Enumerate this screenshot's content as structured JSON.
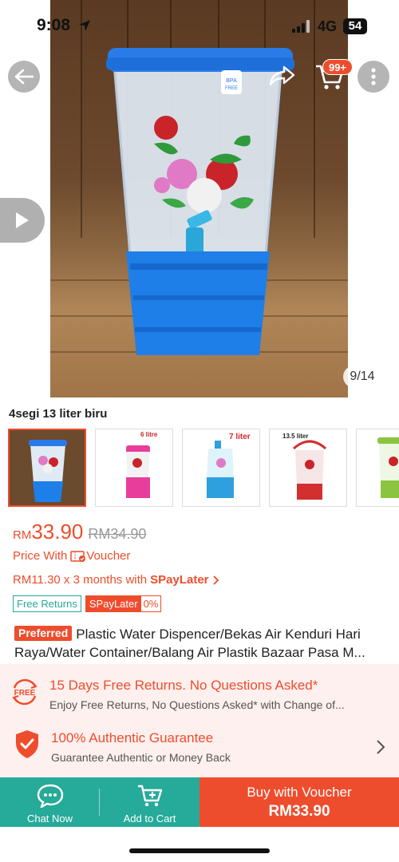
{
  "status": {
    "time": "9:08",
    "network": "4G",
    "battery": "54"
  },
  "top_nav": {
    "cart_badge": "99+"
  },
  "gallery": {
    "counter": "9/14"
  },
  "variation": {
    "name": "4segi 13 liter biru",
    "thumbs": [
      {
        "caption": ""
      },
      {
        "caption": "6 litre"
      },
      {
        "caption": "7 liter"
      },
      {
        "caption": "13.5 liter"
      },
      {
        "caption": ""
      }
    ]
  },
  "price": {
    "currency": "RM",
    "current": "33.90",
    "original": "RM34.90",
    "voucher_label": "Price With",
    "voucher_word": "Voucher",
    "installment_text": "RM11.30 x 3 months with",
    "installment_brand": "SPayLater"
  },
  "tags": {
    "free_returns": "Free Returns",
    "spaylater": "SPayLater",
    "spaylater_rate": "0%"
  },
  "product": {
    "badge": "Preferred",
    "title": "Plastic Water Dispencer/Bekas Air Kenduri Hari Raya/Water Container/Balang Air Plastik Bazaar Pasa M..."
  },
  "guarantees": [
    {
      "icon": "free-returns-icon",
      "title": "15 Days Free Returns. No Questions Asked*",
      "subtitle": "Enjoy Free Returns, No Questions Asked* with Change of..."
    },
    {
      "icon": "shield-check-icon",
      "title": "100% Authentic Guarantee",
      "subtitle": "Guarantee Authentic or Money Back"
    }
  ],
  "bottom_bar": {
    "chat_label": "Chat Now",
    "cart_label": "Add to Cart",
    "buy_label": "Buy with Voucher",
    "buy_price": "RM33.90"
  },
  "colors": {
    "accent": "#ee4d2d",
    "teal": "#26aa99",
    "guarantee_bg": "#fdf0ee"
  }
}
